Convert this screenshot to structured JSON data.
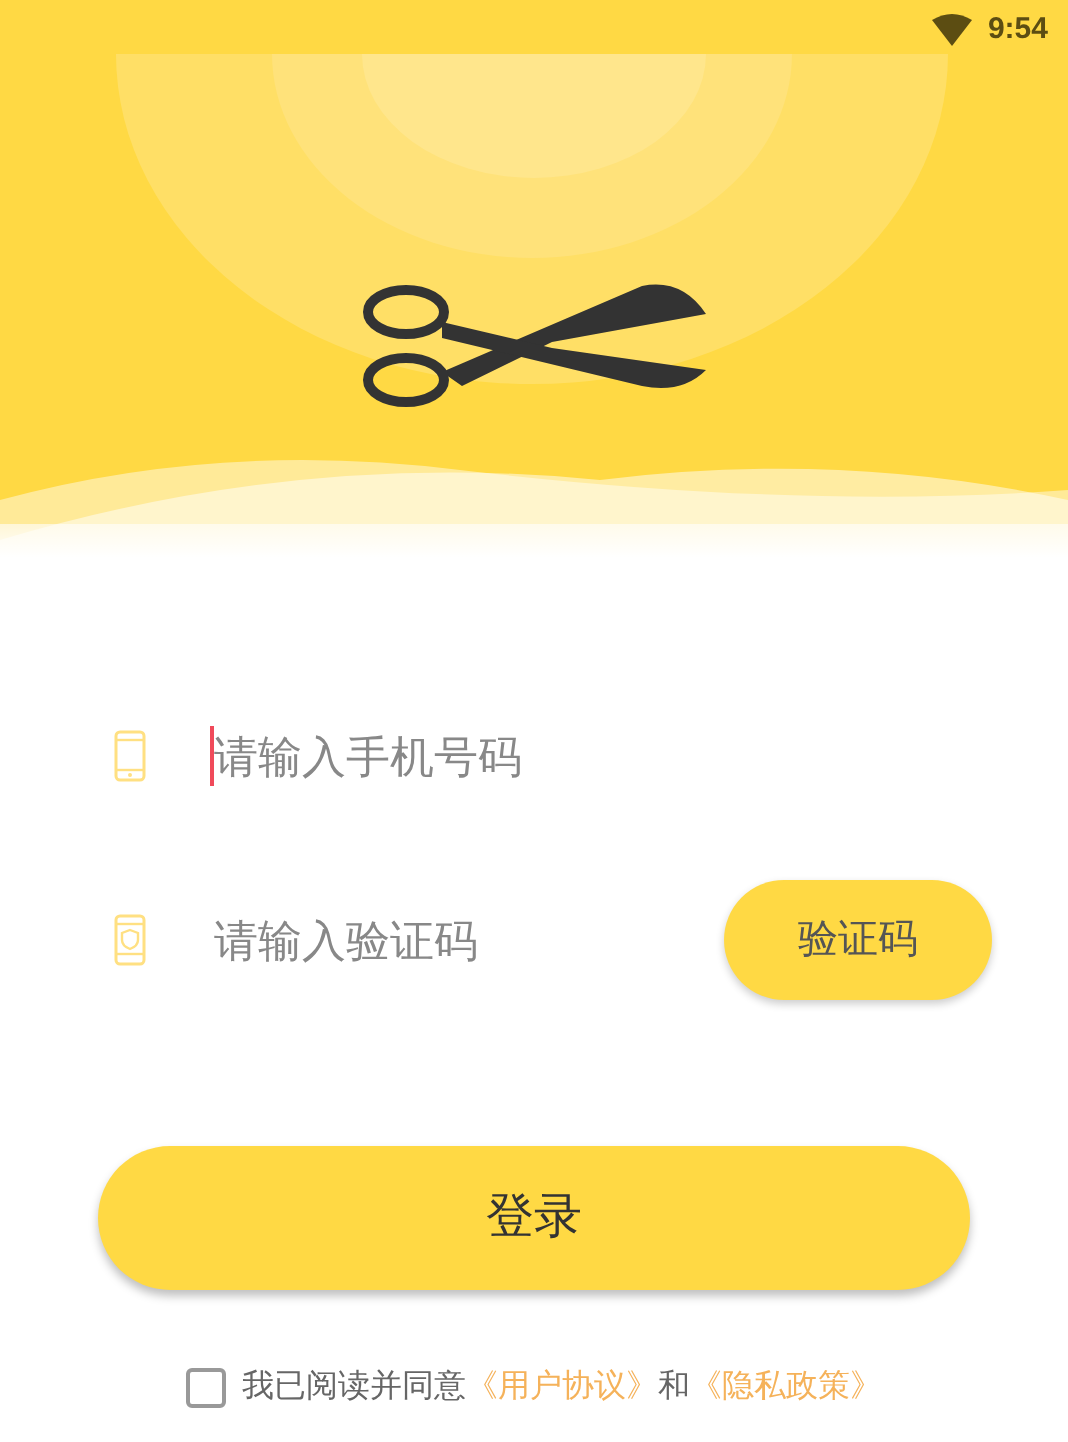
{
  "status_bar": {
    "time": "9:54"
  },
  "fields": [
    {
      "kind": "phone",
      "placeholder": "请输入手机号码",
      "focused": true
    },
    {
      "kind": "code",
      "placeholder": "请输入验证码",
      "focused": false
    }
  ],
  "code_button": "验证码",
  "login_button": "登录",
  "agreement": {
    "checked": false,
    "text": "我已阅读并同意",
    "link_1": "《用户协议》",
    "separator": "和",
    "link_2": "《隐私政策》"
  }
}
